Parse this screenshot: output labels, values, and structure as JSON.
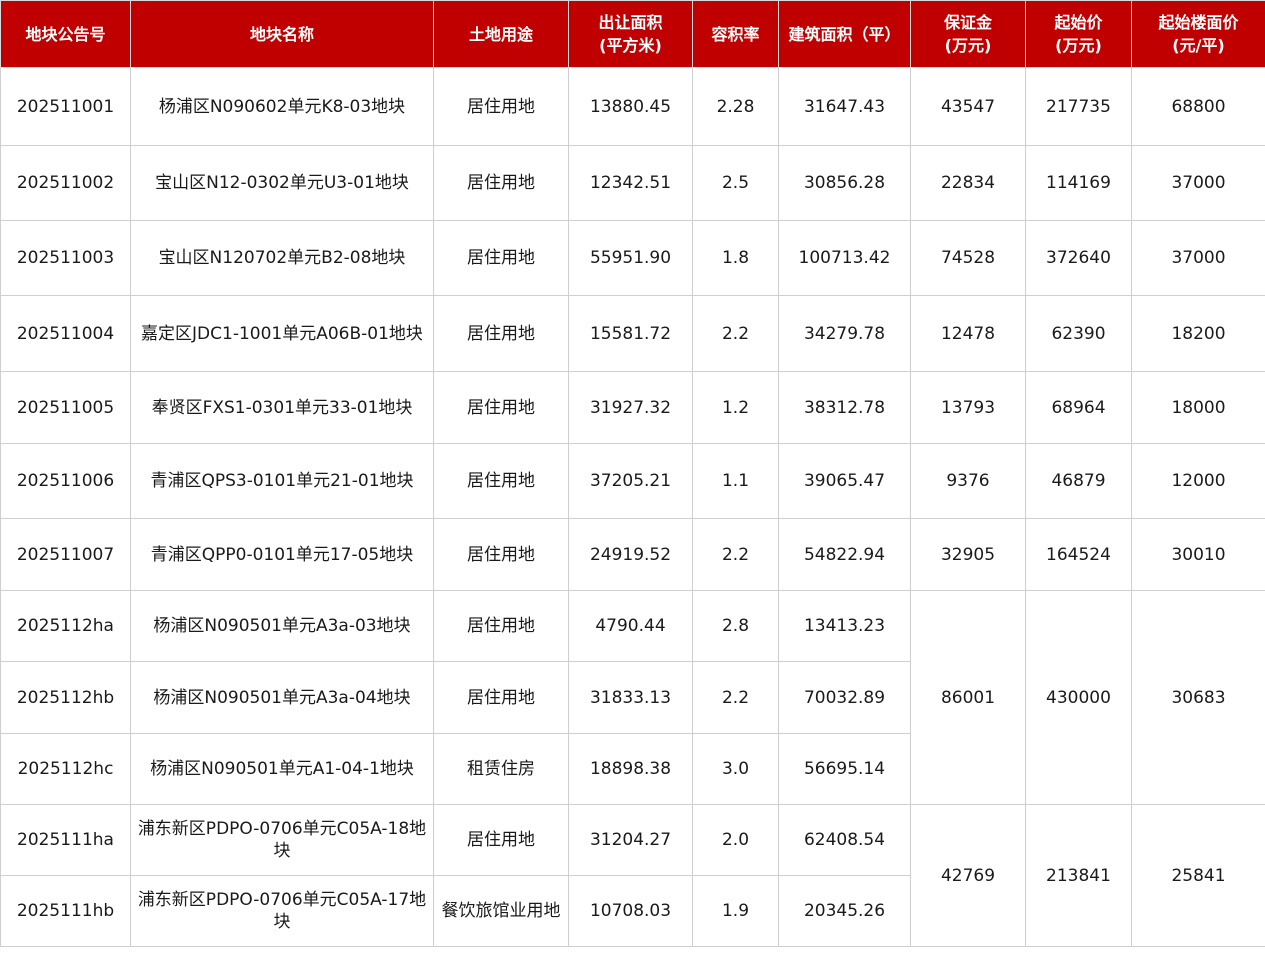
{
  "header": [
    {
      "line1": "地块公告号",
      "line2": ""
    },
    {
      "line1": "地块名称",
      "line2": ""
    },
    {
      "line1": "土地用途",
      "line2": ""
    },
    {
      "line1": "出让面积",
      "line2": "(平方米)"
    },
    {
      "line1": "容积率",
      "line2": ""
    },
    {
      "line1": "建筑面积（平）",
      "line2": ""
    },
    {
      "line1": "保证金",
      "line2": "(万元)"
    },
    {
      "line1": "起始价",
      "line2": "(万元)"
    },
    {
      "line1": "起始楼面价",
      "line2": "(元/平)"
    }
  ],
  "rows": [
    {
      "id": "202511001",
      "name": "杨浦区N090602单元K8-03地块",
      "use": "居住用地",
      "area": "13880.45",
      "far": "2.28",
      "gfa": "31647.43",
      "deposit": "43547",
      "start_price": "217735",
      "floor_price": "68800"
    },
    {
      "id": "202511002",
      "name": "宝山区N12-0302单元U3-01地块",
      "use": "居住用地",
      "area": "12342.51",
      "far": "2.5",
      "gfa": "30856.28",
      "deposit": "22834",
      "start_price": "114169",
      "floor_price": "37000"
    },
    {
      "id": "202511003",
      "name": "宝山区N120702单元B2-08地块",
      "use": "居住用地",
      "area": "55951.90",
      "far": "1.8",
      "gfa": "100713.42",
      "deposit": "74528",
      "start_price": "372640",
      "floor_price": "37000"
    },
    {
      "id": "202511004",
      "name": "嘉定区JDC1-1001单元A06B-01地块",
      "use": "居住用地",
      "area": "15581.72",
      "far": "2.2",
      "gfa": "34279.78",
      "deposit": "12478",
      "start_price": "62390",
      "floor_price": "18200"
    },
    {
      "id": "202511005",
      "name": "奉贤区FXS1-0301单元33-01地块",
      "use": "居住用地",
      "area": "31927.32",
      "far": "1.2",
      "gfa": "38312.78",
      "deposit": "13793",
      "start_price": "68964",
      "floor_price": "18000"
    },
    {
      "id": "202511006",
      "name": "青浦区QPS3-0101单元21-01地块",
      "use": "居住用地",
      "area": "37205.21",
      "far": "1.1",
      "gfa": "39065.47",
      "deposit": "9376",
      "start_price": "46879",
      "floor_price": "12000"
    },
    {
      "id": "202511007",
      "name": "青浦区QPP0-0101单元17-05地块",
      "use": "居住用地",
      "area": "24919.52",
      "far": "2.2",
      "gfa": "54822.94",
      "deposit": "32905",
      "start_price": "164524",
      "floor_price": "30010"
    },
    {
      "id": "2025112ha",
      "name": "杨浦区N090501单元A3a-03地块",
      "use": "居住用地",
      "area": "4790.44",
      "far": "2.8",
      "gfa": "13413.23"
    },
    {
      "id": "2025112hb",
      "name": "杨浦区N090501单元A3a-04地块",
      "use": "居住用地",
      "area": "31833.13",
      "far": "2.2",
      "gfa": "70032.89"
    },
    {
      "id": "2025112hc",
      "name": "杨浦区N090501单元A1-04-1地块",
      "use": "租赁住房",
      "area": "18898.38",
      "far": "3.0",
      "gfa": "56695.14"
    },
    {
      "id": "2025111ha",
      "name": "浦东新区PDPO-0706单元C05A-18地块",
      "use": "居住用地",
      "area": "31204.27",
      "far": "2.0",
      "gfa": "62408.54"
    },
    {
      "id": "2025111hb",
      "name": "浦东新区PDPO-0706单元C05A-17地块",
      "use": "餐饮旅馆业用地",
      "area": "10708.03",
      "far": "1.9",
      "gfa": "20345.26"
    }
  ],
  "groups": [
    {
      "deposit": "86001",
      "start_price": "430000",
      "floor_price": "30683"
    },
    {
      "deposit": "42769",
      "start_price": "213841",
      "floor_price": "25841"
    }
  ]
}
